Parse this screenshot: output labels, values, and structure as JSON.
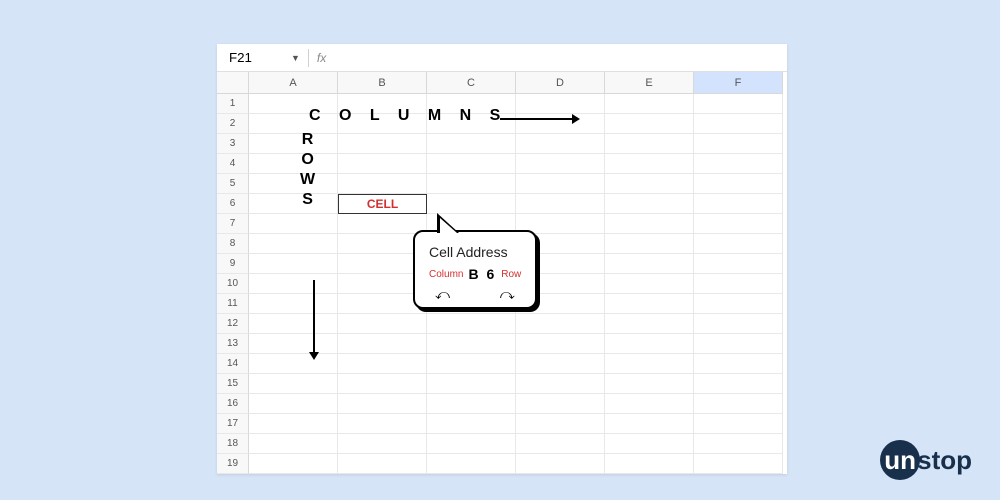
{
  "formula_bar": {
    "cell_ref": "F21",
    "fx": "fx"
  },
  "columns": [
    "A",
    "B",
    "C",
    "D",
    "E",
    "F"
  ],
  "selected_column": "F",
  "rows": 19,
  "active_cell": {
    "row": 6,
    "col": "B",
    "text": "CELL"
  },
  "labels": {
    "columns": "C O L U M N S",
    "rows": "R\nO\nW\nS"
  },
  "callout": {
    "title": "Cell Address",
    "column_label": "Column",
    "row_label": "Row",
    "address": "B 6"
  },
  "brand": {
    "circle": "un",
    "rest": "stop"
  }
}
